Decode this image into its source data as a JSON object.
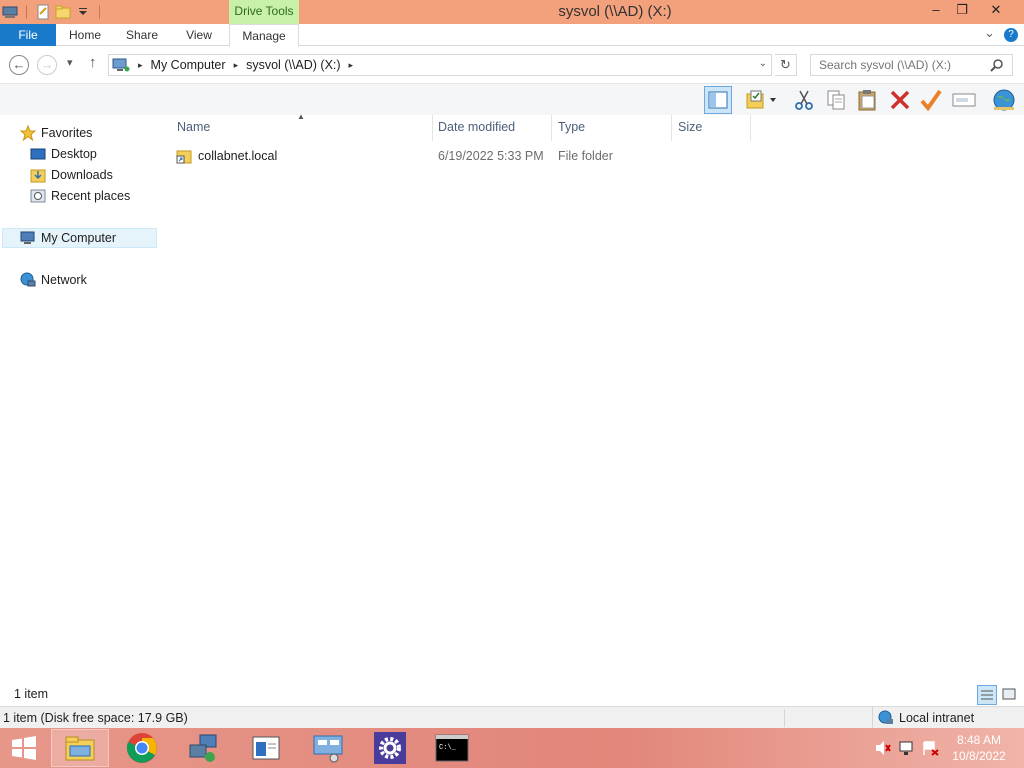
{
  "window": {
    "title": "sysvol (\\\\AD) (X:)",
    "contextual_tab": "Drive Tools",
    "minimize": "–",
    "restore": "❐",
    "close": "✕"
  },
  "ribbon": {
    "tabs": [
      "File",
      "Home",
      "Share",
      "View",
      "Manage"
    ],
    "expand": "⌄",
    "help": "?"
  },
  "address": {
    "back": "←",
    "forward": "→",
    "recent": "▾",
    "up": "↑",
    "crumbs": [
      "My Computer",
      "sysvol (\\\\AD) (X:)"
    ],
    "refresh": "↻",
    "search_placeholder": "Search sysvol (\\\\AD) (X:)"
  },
  "toolbar": {
    "icons": [
      "preview-pane-icon",
      "folder-options-icon",
      "cut-icon",
      "copy-icon",
      "paste-icon",
      "delete-icon",
      "properties-check-icon",
      "rename-icon",
      "globe-icon"
    ]
  },
  "nav": {
    "favorites": "Favorites",
    "desktop": "Desktop",
    "downloads": "Downloads",
    "recent_places": "Recent places",
    "my_computer": "My Computer",
    "network": "Network"
  },
  "columns": {
    "name": "Name",
    "date_modified": "Date modified",
    "type": "Type",
    "size": "Size"
  },
  "files": [
    {
      "name": "collabnet.local",
      "date_modified": "6/19/2022 5:33 PM",
      "type": "File folder",
      "size": ""
    }
  ],
  "status": {
    "item_count": "1 item",
    "detail": "1 item (Disk free space: 17.9 GB)",
    "zone": "Local intranet"
  },
  "taskbar": {
    "apps": [
      "start-icon",
      "file-explorer-icon",
      "chrome-icon",
      "network-admin-icon",
      "server-manager-icon",
      "remote-desktop-icon",
      "settings-icon",
      "command-prompt-icon"
    ],
    "time": "8:48 AM",
    "date": "10/8/2022"
  },
  "colors": {
    "titlebar": "#f3a07c",
    "file_tab": "#1979ca",
    "contextual_tab": "#c8f0a8",
    "taskbar": "#e4887a"
  }
}
